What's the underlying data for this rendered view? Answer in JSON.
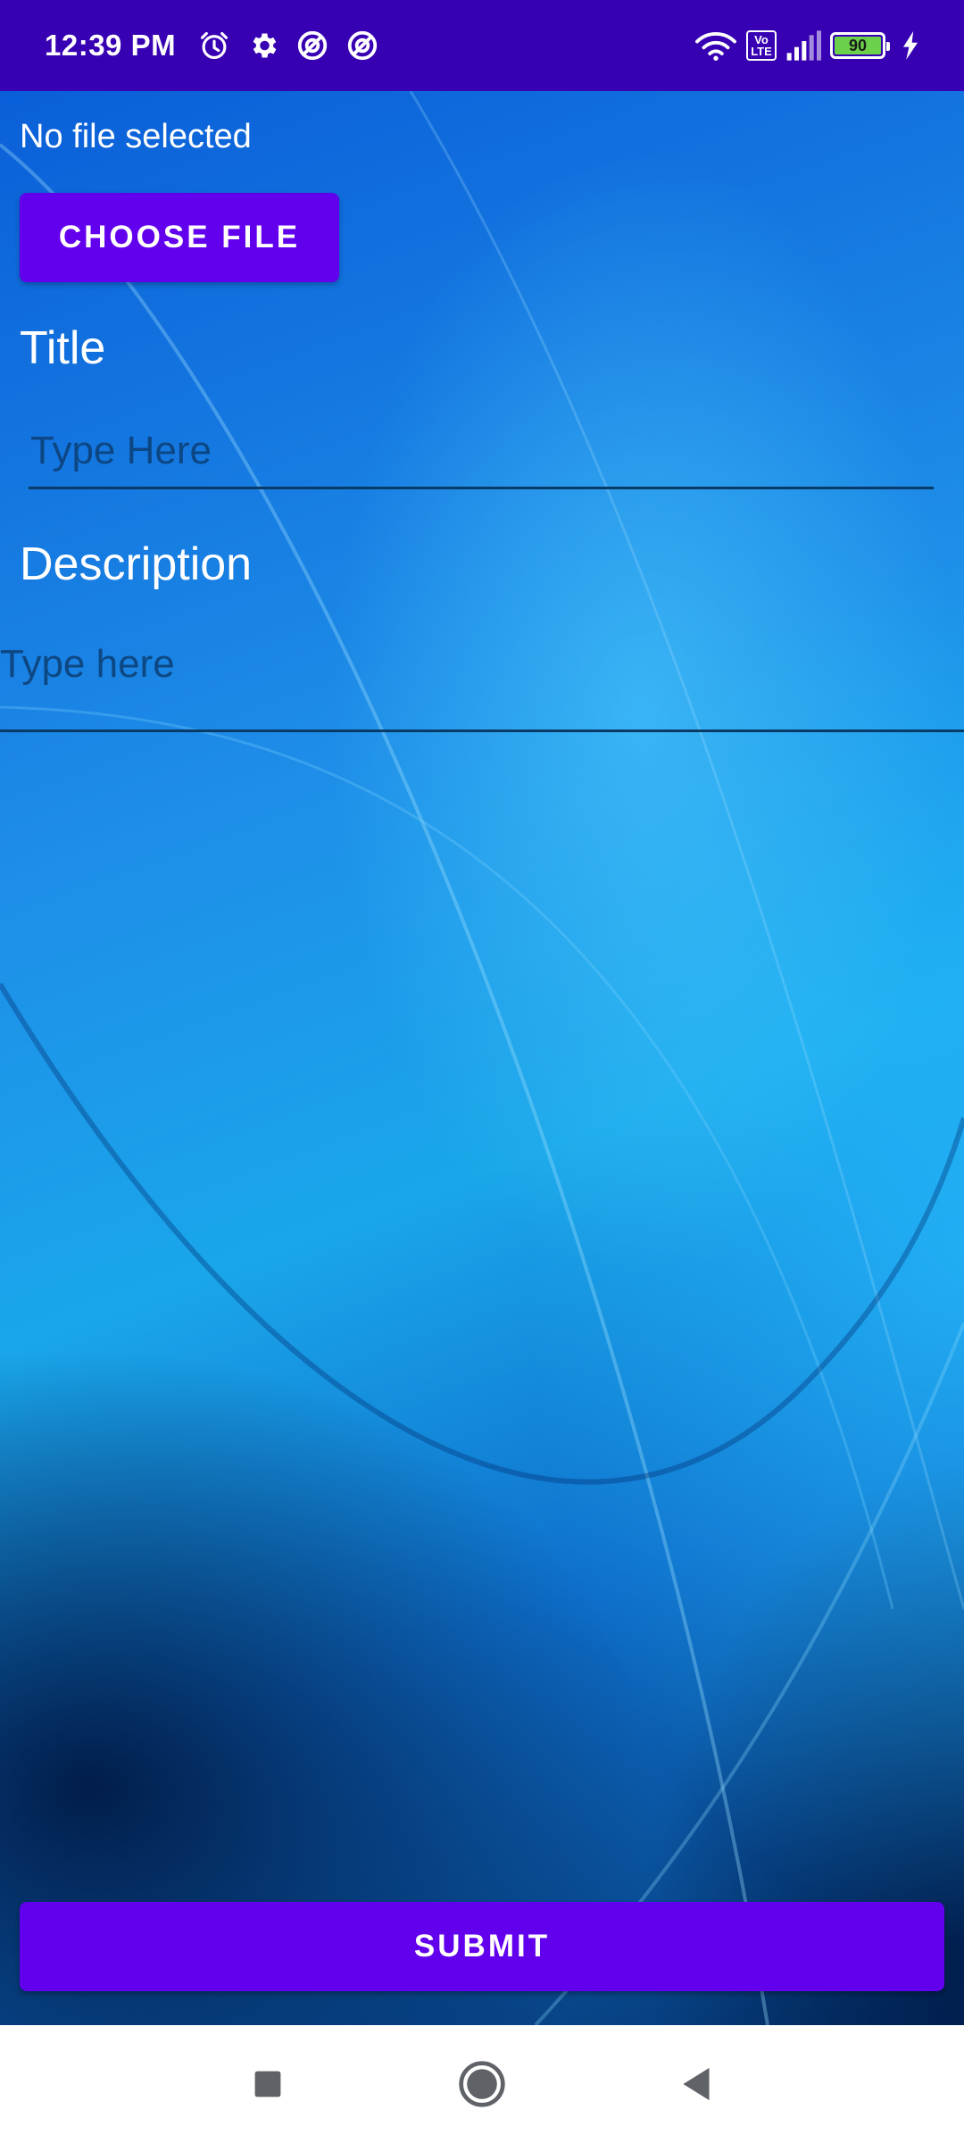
{
  "status_bar": {
    "time": "12:39 PM",
    "battery_level": "90",
    "network_badge": "Vo\nLTE",
    "icons": [
      "alarm-icon",
      "gear-icon",
      "sync-blocked-icon",
      "sync-blocked-icon",
      "wifi-icon",
      "volte-icon",
      "signal-icon",
      "battery-icon",
      "charging-icon"
    ]
  },
  "form": {
    "file_status": "No file selected",
    "choose_file_label": "CHOOSE FILE",
    "title_label": "Title",
    "title_placeholder": "Type Here",
    "description_label": "Description",
    "description_placeholder": "Type here",
    "submit_label": "SUBMIT"
  },
  "colors": {
    "status_bar": "#3700b3",
    "primary_button": "#6200ee",
    "text": "#ffffff"
  },
  "nav_bar": {
    "items": [
      "recents-button",
      "home-button",
      "back-button"
    ]
  }
}
